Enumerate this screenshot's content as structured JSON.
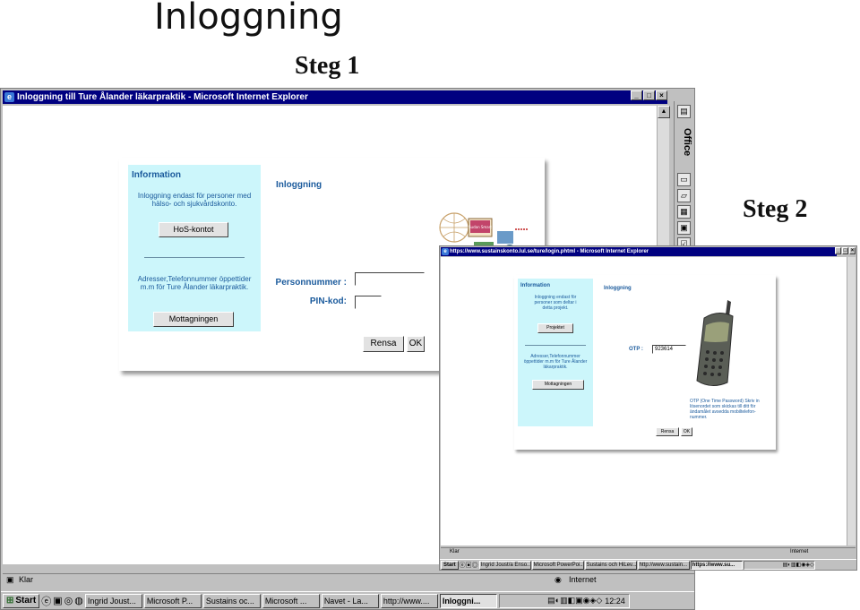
{
  "slide": {
    "title": "Inloggning",
    "step1": "Steg 1",
    "step2": "Steg 2"
  },
  "window1": {
    "title": "Inloggning till Ture Ålander läkarpraktik - Microsoft Internet Explorer",
    "office_label": "Office",
    "info": {
      "title": "Information",
      "text1": "Inloggning endast för personer med hälso- och sjukvårdskonto.",
      "button1": "HoS-kontot",
      "text2": "Adresser,Telefonnummer öppettider m.m för Ture Ålander läkarpraktik.",
      "button2": "Mottagningen"
    },
    "login": {
      "heading": "Inloggning",
      "personnummer_label": "Personnummer :",
      "personnummer_value": "",
      "pin_label": "PIN-kod:",
      "pin_value": "",
      "reset_button": "Rensa",
      "ok_button": "OK"
    },
    "graphic_text": "Sudan Smart",
    "status_text": "Klar",
    "zone_text": "Internet"
  },
  "window2": {
    "title": "https://www.sustainskonto.lul.se/ture/login.phtml - Microsoft Internet Explorer",
    "info": {
      "title": "Information",
      "text1": "Inloggning endast för personer som deltar i detta projekt.",
      "button1": "Projektet",
      "text2": "Adresser,Telefonnummer öppettider m.m för Ture Ålander läkarpraktik.",
      "button2": "Mottagningen"
    },
    "login": {
      "heading": "Inloggning",
      "otp_label": "OTP :",
      "otp_value": "923614",
      "otp_note": "OTP (One Time Password) Skriv in lösenordet som skickas till ditt för ändamålet avsedda mobiltelefon-nummer.",
      "reset_button": "Rensa",
      "ok_button": "OK"
    },
    "status_text": "Klar",
    "zone_text": "Internet"
  },
  "taskbar1": {
    "start": "Start",
    "tasks": [
      "Ingrid Joust...",
      "Microsoft P...",
      "Sustains oc...",
      "Microsoft ...",
      "Navet - La...",
      "http://www....",
      "Inloggni..."
    ],
    "clock": "12:24"
  },
  "taskbar2": {
    "start": "Start",
    "tasks": [
      "Ingrid Joust/a Enso...",
      "Microsoft PowerPoi...",
      "Sustains och HiLev...",
      "http://www.sustain...",
      "https://www.su..."
    ]
  }
}
